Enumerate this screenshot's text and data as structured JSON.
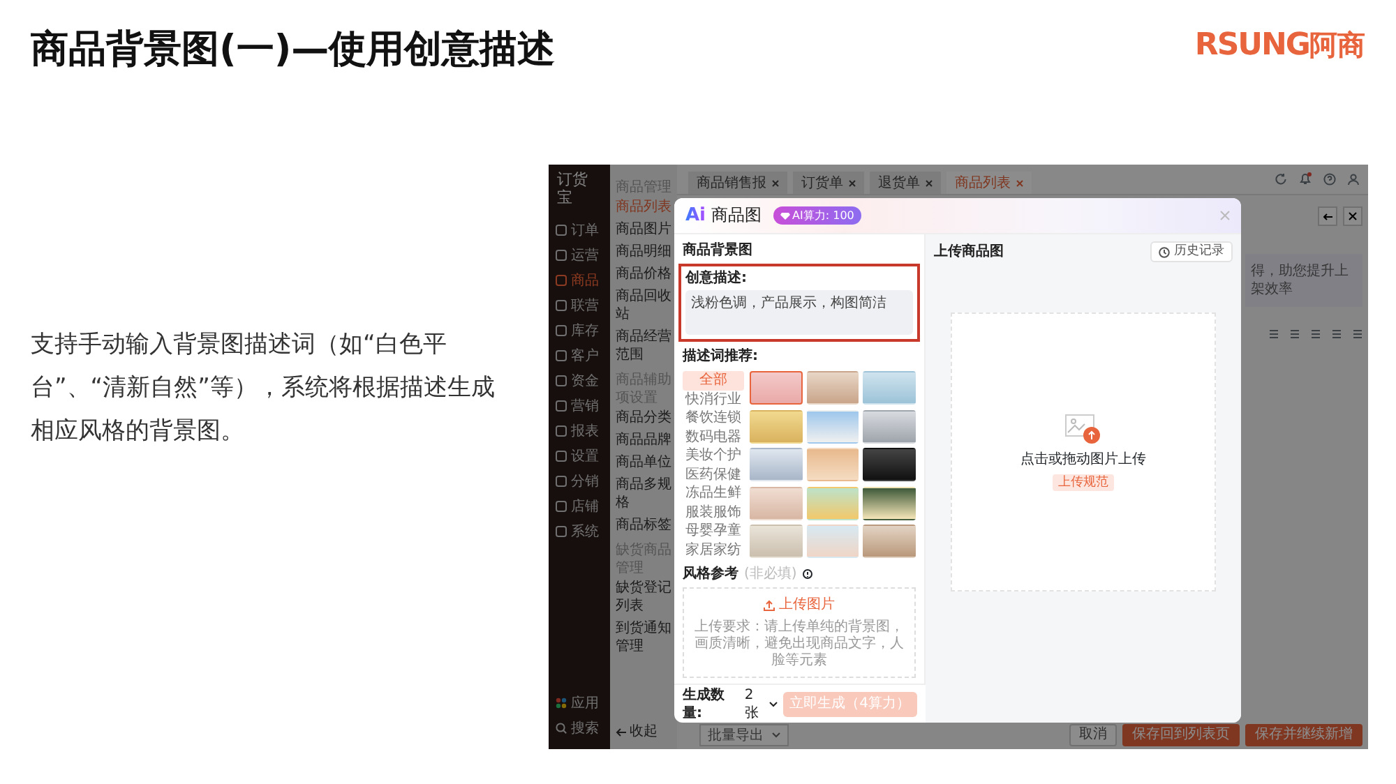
{
  "slide": {
    "title": "商品背景图(一)—使用创意描述",
    "logo": {
      "latin": "RSUNG",
      "cjk": "阿商"
    },
    "description": "支持手动输入背景图描述词（如“白色平台”、“清新自然”等），系统将根据描述生成相应风格的背景图。"
  },
  "app": {
    "brand": "订货宝",
    "nav": [
      {
        "label": "订单",
        "selected": false
      },
      {
        "label": "运营",
        "selected": false
      },
      {
        "label": "商品",
        "selected": true
      },
      {
        "label": "联营",
        "selected": false
      },
      {
        "label": "库存",
        "selected": false
      },
      {
        "label": "客户",
        "selected": false
      },
      {
        "label": "资金",
        "selected": false
      },
      {
        "label": "营销",
        "selected": false
      },
      {
        "label": "报表",
        "selected": false
      },
      {
        "label": "设置",
        "selected": false
      },
      {
        "label": "分销",
        "selected": false
      },
      {
        "label": "店铺",
        "selected": false
      },
      {
        "label": "系统",
        "selected": false
      }
    ],
    "nav_bottom": [
      "应用",
      "搜索"
    ],
    "submenu": [
      {
        "kind": "section",
        "label": "商品管理"
      },
      {
        "kind": "item",
        "label": "商品列表",
        "selected": true
      },
      {
        "kind": "item",
        "label": "商品图片",
        "selected": false
      },
      {
        "kind": "item",
        "label": "商品明细",
        "selected": false
      },
      {
        "kind": "item",
        "label": "商品价格",
        "selected": false
      },
      {
        "kind": "item",
        "label": "商品回收站",
        "selected": false
      },
      {
        "kind": "item",
        "label": "商品经营范围",
        "selected": false
      },
      {
        "kind": "section",
        "label": "商品辅助项设置"
      },
      {
        "kind": "item",
        "label": "商品分类",
        "selected": false
      },
      {
        "kind": "item",
        "label": "商品品牌",
        "selected": false
      },
      {
        "kind": "item",
        "label": "商品单位",
        "selected": false
      },
      {
        "kind": "item",
        "label": "商品多规格",
        "selected": false
      },
      {
        "kind": "item",
        "label": "商品标签",
        "selected": false
      },
      {
        "kind": "section",
        "label": "缺货商品管理"
      },
      {
        "kind": "item",
        "label": "缺货登记列表",
        "selected": false
      },
      {
        "kind": "item",
        "label": "到货通知管理",
        "selected": false
      }
    ],
    "collapse": "收起",
    "tabs": [
      {
        "label": "商品销售报",
        "selected": false
      },
      {
        "label": "订货单",
        "selected": false
      },
      {
        "label": "退货单",
        "selected": false
      },
      {
        "label": "商品列表",
        "selected": true
      }
    ],
    "hint_fragment": "得，助您提升上架效率",
    "export_select": "批量导出",
    "buttons": [
      {
        "label": "取消",
        "kind": "default"
      },
      {
        "label": "保存回到列表页",
        "kind": "primary"
      },
      {
        "label": "保存并继续新增",
        "kind": "primary"
      }
    ]
  },
  "dialog": {
    "logo": "Ai",
    "title": "商品图",
    "quota": "AI算力: 100",
    "left": {
      "heading": "商品背景图",
      "prompt_label": "创意描述:",
      "prompt_value": "浅粉色调，产品展示，构图简洁",
      "suggest_label": "描述词推荐:",
      "categories": [
        {
          "label": "全部",
          "selected": true
        },
        {
          "label": "快消行业",
          "selected": false
        },
        {
          "label": "餐饮连锁",
          "selected": false
        },
        {
          "label": "数码电器",
          "selected": false
        },
        {
          "label": "美妆个护",
          "selected": false
        },
        {
          "label": "医药保健",
          "selected": false
        },
        {
          "label": "冻品生鲜",
          "selected": false
        },
        {
          "label": "服装服饰",
          "selected": false
        },
        {
          "label": "母婴孕童",
          "selected": false
        },
        {
          "label": "家居家纺",
          "selected": false
        }
      ],
      "thumbnails": [
        {
          "selected": true
        },
        {
          "selected": false
        },
        {
          "selected": false
        },
        {
          "selected": false
        },
        {
          "selected": false
        },
        {
          "selected": false
        },
        {
          "selected": false
        },
        {
          "selected": false
        },
        {
          "selected": false
        },
        {
          "selected": false
        },
        {
          "selected": false
        },
        {
          "selected": false
        },
        {
          "selected": false
        },
        {
          "selected": false
        },
        {
          "selected": false
        }
      ],
      "style_label": "风格参考",
      "style_optional": "(非必填)",
      "upload_button": "上传图片",
      "upload_requirement": "上传要求：请上传单纯的背景图，画质清晰，避免出现商品文字，人脸等元素",
      "quantity_label": "生成数量:",
      "quantity_value": "2张",
      "generate_button": {
        "label": "立即生成（4算力）",
        "disabled": true
      }
    },
    "right": {
      "heading": "上传商品图",
      "history_button": "历史记录",
      "drop_text": "点击或拖动图片上传",
      "spec_link": "上传规范"
    }
  }
}
